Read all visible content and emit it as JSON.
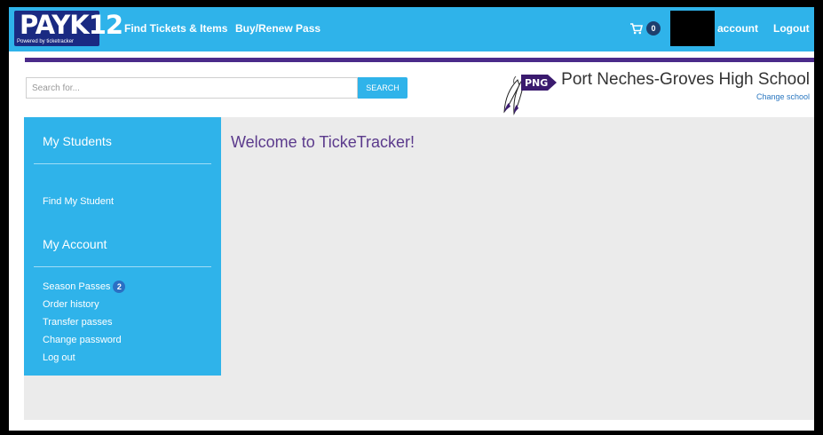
{
  "brand": {
    "logo_text": "PAYK12",
    "logo_sub": "Powered by ticketracker"
  },
  "nav": {
    "find_tickets": "Find Tickets & Items",
    "buy_renew": "Buy/Renew Pass",
    "cart_count": "0",
    "account": "account",
    "logout": "Logout"
  },
  "search": {
    "placeholder": "Search for...",
    "button_label": "SEARCH"
  },
  "school": {
    "logo_text": "PNG",
    "name": "Port Neches-Groves High School",
    "change_label": "Change school"
  },
  "sidebar": {
    "students_heading": "My Students",
    "find_student": "Find My Student",
    "account_heading": "My Account",
    "season_passes": "Season Passes",
    "season_passes_count": "2",
    "order_history": "Order history",
    "transfer_passes": "Transfer passes",
    "change_password": "Change password",
    "log_out": "Log out"
  },
  "main": {
    "welcome": "Welcome to TickeTracker!"
  },
  "colors": {
    "nav_blue": "#2fb3ea",
    "brand_purple": "#4a2a8a",
    "welcome_purple": "#5b3a8c",
    "content_gray": "#ebebeb"
  }
}
